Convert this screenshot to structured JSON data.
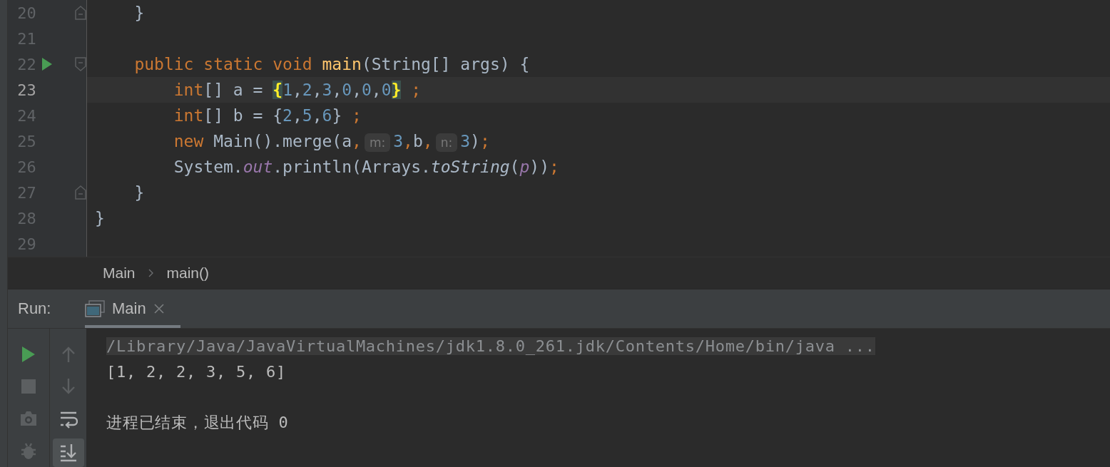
{
  "editor": {
    "lines": [
      {
        "number": "20",
        "current": false,
        "run_marker": false,
        "fold_start": false,
        "fold_end": true,
        "tokens": [
          {
            "kind": "plain",
            "text": "    }"
          }
        ]
      },
      {
        "number": "21",
        "current": false,
        "run_marker": false,
        "fold_start": false,
        "fold_end": false
      },
      {
        "number": "22",
        "current": false,
        "run_marker": true,
        "fold_start": true,
        "fold_end": false,
        "tokens": [
          {
            "kind": "kw",
            "text": "    public static void "
          },
          {
            "kind": "fn",
            "text": "main"
          },
          {
            "kind": "plain",
            "text": "(String[] args) {"
          }
        ]
      },
      {
        "number": "23",
        "current": true,
        "run_marker": false,
        "fold_start": false,
        "fold_end": false,
        "tokens": [
          {
            "kind": "kw",
            "text": "        int"
          },
          {
            "kind": "plain",
            "text": "[] a = "
          },
          {
            "kind": "brace",
            "text": "{"
          },
          {
            "kind": "num",
            "text": "1"
          },
          {
            "kind": "plain",
            "text": ","
          },
          {
            "kind": "num",
            "text": "2"
          },
          {
            "kind": "plain",
            "text": ","
          },
          {
            "kind": "num",
            "text": "3"
          },
          {
            "kind": "plain",
            "text": ","
          },
          {
            "kind": "num",
            "text": "0"
          },
          {
            "kind": "plain",
            "text": ","
          },
          {
            "kind": "num",
            "text": "0"
          },
          {
            "kind": "plain",
            "text": ","
          },
          {
            "kind": "num",
            "text": "0"
          },
          {
            "kind": "brace",
            "text": "}"
          },
          {
            "kind": "kw",
            "text": " ;"
          }
        ]
      },
      {
        "number": "24",
        "current": false,
        "run_marker": false,
        "fold_start": false,
        "fold_end": false,
        "tokens": [
          {
            "kind": "kw",
            "text": "        int"
          },
          {
            "kind": "plain",
            "text": "[] b = {"
          },
          {
            "kind": "num",
            "text": "2"
          },
          {
            "kind": "plain",
            "text": ","
          },
          {
            "kind": "num",
            "text": "5"
          },
          {
            "kind": "plain",
            "text": ","
          },
          {
            "kind": "num",
            "text": "6"
          },
          {
            "kind": "plain",
            "text": "} "
          },
          {
            "kind": "kw",
            "text": ";"
          }
        ]
      },
      {
        "number": "25",
        "current": false,
        "run_marker": false,
        "fold_start": false,
        "fold_end": false,
        "tokens": [
          {
            "kind": "kw",
            "text": "        new"
          },
          {
            "kind": "plain",
            "text": " Main().merge(a"
          },
          {
            "kind": "kw",
            "text": ","
          },
          {
            "kind": "hint",
            "text": "m:"
          },
          {
            "kind": "num",
            "text": "3"
          },
          {
            "kind": "kw",
            "text": ","
          },
          {
            "kind": "plain",
            "text": "b"
          },
          {
            "kind": "kw",
            "text": ","
          },
          {
            "kind": "hint",
            "text": "n:"
          },
          {
            "kind": "num",
            "text": "3"
          },
          {
            "kind": "plain",
            "text": ")"
          },
          {
            "kind": "kw",
            "text": ";"
          }
        ]
      },
      {
        "number": "26",
        "current": false,
        "run_marker": false,
        "fold_start": false,
        "fold_end": false,
        "tokens": [
          {
            "kind": "plain",
            "text": "        System."
          },
          {
            "kind": "field",
            "text": "out"
          },
          {
            "kind": "plain",
            "text": ".println(Arrays."
          },
          {
            "kind": "static",
            "text": "toString"
          },
          {
            "kind": "plain",
            "text": "("
          },
          {
            "kind": "field",
            "text": "p"
          },
          {
            "kind": "plain",
            "text": "))"
          },
          {
            "kind": "kw",
            "text": ";"
          }
        ]
      },
      {
        "number": "27",
        "current": false,
        "run_marker": false,
        "fold_start": false,
        "fold_end": true,
        "tokens": [
          {
            "kind": "plain",
            "text": "    }"
          }
        ]
      },
      {
        "number": "28",
        "current": false,
        "run_marker": false,
        "fold_start": false,
        "fold_end": false,
        "tokens": [
          {
            "kind": "plain",
            "text": "}"
          }
        ]
      },
      {
        "number": "29",
        "current": false,
        "run_marker": false,
        "fold_start": false,
        "fold_end": false
      }
    ]
  },
  "breadcrumbs": [
    "Main",
    "main()"
  ],
  "run_panel": {
    "label": "Run:",
    "tabs": [
      {
        "label": "Main",
        "selected": true
      }
    ],
    "left_toolbar": [
      {
        "kind": "run",
        "disabled": false
      },
      {
        "kind": "stop",
        "disabled": true
      },
      {
        "kind": "camera",
        "disabled": true
      },
      {
        "kind": "bug",
        "disabled": true
      }
    ],
    "right_toolbar": [
      {
        "kind": "up",
        "disabled": true,
        "selected": false
      },
      {
        "kind": "down",
        "disabled": true,
        "selected": false
      },
      {
        "kind": "wrap",
        "disabled": false,
        "selected": false
      },
      {
        "kind": "scroll_end",
        "disabled": false,
        "selected": true
      }
    ],
    "console": [
      {
        "kind": "command",
        "text": "/Library/Java/JavaVirtualMachines/jdk1.8.0_261.jdk/Contents/Home/bin/java ..."
      },
      {
        "kind": "output",
        "text": "[1, 2, 2, 3, 5, 6]"
      },
      {
        "kind": "blank"
      },
      {
        "kind": "output",
        "text": "进程已结束，退出代码 0"
      }
    ]
  }
}
